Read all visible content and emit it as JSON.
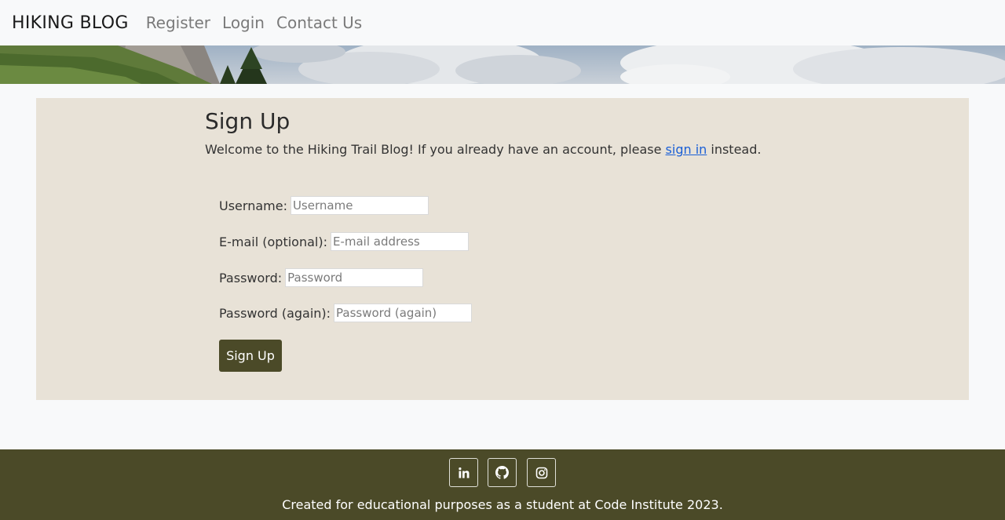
{
  "nav": {
    "brand": "HIKING BLOG",
    "links": [
      "Register",
      "Login",
      "Contact Us"
    ]
  },
  "signup": {
    "title": "Sign Up",
    "welcome_prefix": "Welcome to the Hiking Trail Blog! If you already have an account, please ",
    "signin_link": "sign in",
    "welcome_suffix": " instead.",
    "fields": [
      {
        "label": "Username:",
        "placeholder": "Username"
      },
      {
        "label": "E-mail (optional):",
        "placeholder": "E-mail address"
      },
      {
        "label": "Password:",
        "placeholder": "Password"
      },
      {
        "label": "Password (again):",
        "placeholder": "Password (again)"
      }
    ],
    "submit_label": "Sign Up"
  },
  "footer": {
    "social": [
      "linkedin-icon",
      "github-icon",
      "instagram-icon"
    ],
    "text": "Created for educational purposes as a student at Code Institute 2023."
  },
  "colors": {
    "accent": "#4b4a28",
    "card": "#e8e2d7",
    "link": "#1a5fd6"
  }
}
